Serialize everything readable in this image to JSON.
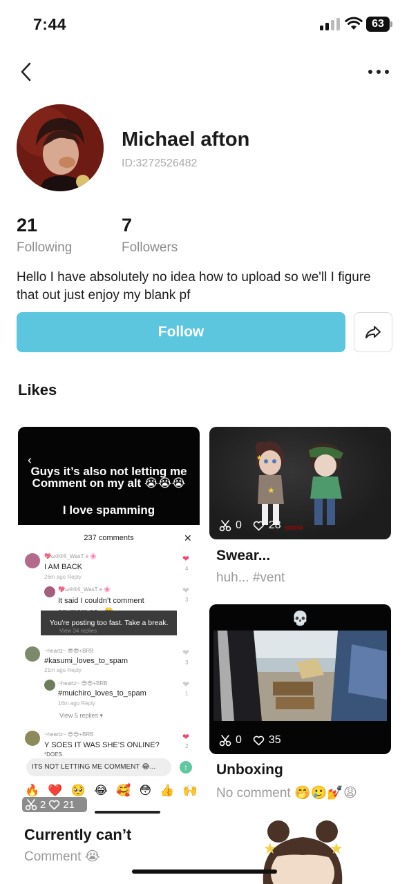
{
  "status_bar": {
    "time": "7:44",
    "battery": "63"
  },
  "profile": {
    "name": "Michael afton",
    "id": "ID:3272526482",
    "following_count": "21",
    "following_label": "Following",
    "followers_count": "7",
    "followers_label": "Followers",
    "bio": "Hello I have absolutely no idea how to upload so we'll I figure that out just enjoy my blank pf"
  },
  "actions": {
    "follow_label": "Follow"
  },
  "likes": {
    "title": "Likes",
    "cards": [
      {
        "overlay_line1": "Guys it’s also not letting me",
        "overlay_line2": "Comment on my alt 😭😭😭",
        "overlay_line3": "I love spamming",
        "comments_header": "237 comments",
        "comments": [
          {
            "user": "💖ω®®¢_WasT e 🌸",
            "text": "I AM BACK",
            "meta": "26m ago   Reply",
            "likes": "4",
            "heart": "red"
          },
          {
            "user": "💖ω®®¢_WasT e 🌸",
            "text": "It said I couldn’t comment",
            "meta": "",
            "likes": "3",
            "heart": "grey"
          },
          {
            "user": "~heartz~ 😎😎+BRB",
            "text": "#kasumi_loves_to_spam",
            "meta": "21m ago   Reply",
            "likes": "3",
            "heart": "grey"
          },
          {
            "user": "~heartz~ 😎😎+BRB",
            "text": "#muichiro_loves_to_spam",
            "meta": "16m ago   Reply",
            "likes": "1",
            "heart": "grey"
          },
          {
            "user": "~heartz~ 😎😎+BRB",
            "text": "Y SOES IT WAS SHE’S ONLINE?",
            "meta": "",
            "likes": "2",
            "heart": "red"
          }
        ],
        "partial_text_1": "anymore so.. 😬",
        "partial_text_2": "View 34 replies",
        "view_replies": "View 5 replies ▾",
        "toast": "You're posting too fast. Take a break.",
        "input_text": "ITS NOT LETTING ME COMMENT 😂...",
        "emoji_bar": [
          "🔥",
          "❤️",
          "🥺",
          "😂",
          "🥰",
          "😳",
          "👍",
          "🙌"
        ],
        "partial_text_3": "*DOES",
        "stats_cuts": "2",
        "stats_likes": "21",
        "title": "Currently can’t",
        "subtitle": "Comment 😭"
      },
      {
        "stats_cuts": "0",
        "stats_likes": "28",
        "title": "Swear...",
        "subtitle": "huh... #vent"
      },
      {
        "header_emoji": "💀",
        "stats_cuts": "0",
        "stats_likes": "35",
        "title": "Unboxing",
        "subtitle": "No comment 🤭🥲💅😩"
      }
    ]
  },
  "colors": {
    "follow_button": "#5cc6df",
    "heart_red": "#f0466a",
    "muted_text": "#9a9a9a"
  },
  "icons": [
    "back-chevron-icon",
    "more-dots-icon",
    "share-arrow-icon",
    "scissors-icon",
    "heart-outline-icon",
    "signal-icon",
    "wifi-icon",
    "battery-icon"
  ]
}
